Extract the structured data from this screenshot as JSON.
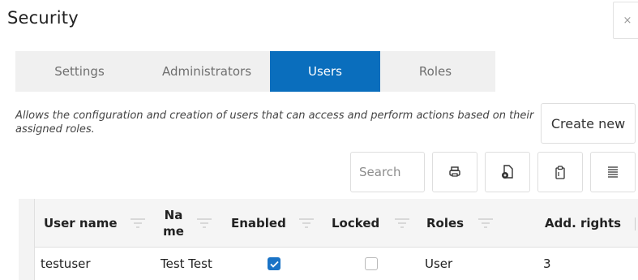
{
  "dialog": {
    "title": "Security",
    "close_label": "×"
  },
  "tabs": [
    {
      "label": "Settings",
      "active": false
    },
    {
      "label": "Administrators",
      "active": false
    },
    {
      "label": "Users",
      "active": true
    },
    {
      "label": "Roles",
      "active": false
    }
  ],
  "description": "Allows the configuration and creation of users that can access and perform actions based on their assigned roles.",
  "toolbar": {
    "create_label": "Create new",
    "search_placeholder": "Search",
    "buttons": [
      "print-icon",
      "export-icon",
      "clipboard-icon",
      "columns-icon"
    ]
  },
  "grid": {
    "columns": {
      "username": "User name",
      "name_line1": "Na",
      "name_line2": "me",
      "enabled": "Enabled",
      "locked": "Locked",
      "roles": "Roles",
      "add_rights": "Add. rights"
    },
    "rows": [
      {
        "username": "testuser",
        "name": "Test Test",
        "enabled": true,
        "locked": false,
        "roles": "User",
        "add_rights": "3"
      }
    ]
  },
  "colors": {
    "accent": "#0a6ebd",
    "checkbox": "#1a73c6"
  }
}
